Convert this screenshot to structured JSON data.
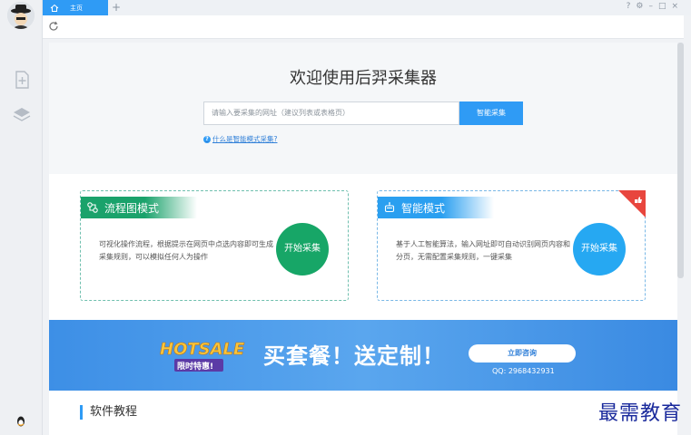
{
  "topbar": {
    "tab_label": "主页",
    "add_tab": "+",
    "window_controls": [
      "?",
      "⚙",
      "–",
      "□",
      "×"
    ]
  },
  "hero": {
    "title": "欢迎使用后羿采集器",
    "search_placeholder": "请输入要采集的网址（建议列表或表格页）",
    "search_button": "智能采集",
    "help_link": "什么是智能模式采集?"
  },
  "cards": {
    "flow": {
      "title": "流程图模式",
      "description": "可视化操作流程，根据提示在网页中点选内容即可生成采集规则，可以模拟任何人为操作",
      "button": "开始采集"
    },
    "ai": {
      "title": "智能模式",
      "description": "基于人工智能算法，输入网址即可自动识别网页内容和分页，无需配置采集规则，一键采集",
      "button": "开始采集"
    }
  },
  "banner": {
    "hotsale": "HOTSALE",
    "hotsale_sub": "限时特惠!",
    "title": "买套餐！送定制！",
    "consult_button": "立即咨询",
    "qq": "QQ: 2968432931"
  },
  "section": {
    "tutorial_title": "软件教程"
  },
  "watermark": "最需教育",
  "colors": {
    "accent": "#2f9bf5",
    "flow_green": "#17a667",
    "ai_blue": "#26a8f2"
  }
}
